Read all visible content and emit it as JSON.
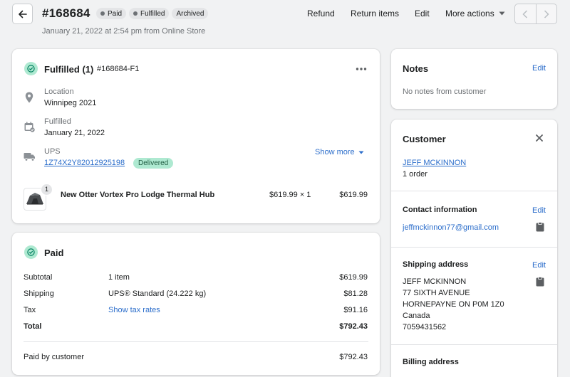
{
  "header": {
    "order_number": "#168684",
    "badges": [
      "Paid",
      "Fulfilled",
      "Archived"
    ],
    "subtitle": "January 21, 2022 at 2:54 pm from Online Store",
    "actions": {
      "refund": "Refund",
      "return_items": "Return items",
      "edit": "Edit",
      "more_actions": "More actions"
    }
  },
  "fulfilled": {
    "title": "Fulfilled (1)",
    "fulfillment_id": "#168684-F1",
    "location_label": "Location",
    "location_value": "Winnipeg 2021",
    "fulfilled_label": "Fulfilled",
    "fulfilled_value": "January 21, 2022",
    "carrier": "UPS",
    "tracking_number": "1Z74X2Y82012925198",
    "tracking_status": "Delivered",
    "show_more": "Show more",
    "item": {
      "quantity_badge": "1",
      "name": "New Otter Vortex Pro Lodge Thermal Hub",
      "unit_price": "$619.99 × 1",
      "total": "$619.99"
    }
  },
  "paid": {
    "title": "Paid",
    "rows": [
      {
        "label": "Subtotal",
        "detail": "1 item",
        "amount": "$619.99"
      },
      {
        "label": "Shipping",
        "detail": "UPS® Standard (24.222 kg)",
        "amount": "$81.28"
      },
      {
        "label": "Tax",
        "detail": "Show tax rates",
        "amount": "$91.16"
      },
      {
        "label": "Total",
        "detail": "",
        "amount": "$792.43"
      }
    ],
    "paid_by_label": "Paid by customer",
    "paid_by_amount": "$792.43"
  },
  "notes": {
    "title": "Notes",
    "edit": "Edit",
    "empty": "No notes from customer"
  },
  "customer": {
    "title": "Customer",
    "name": "JEFF MCKINNON",
    "orders": "1 order",
    "contact_title": "Contact information",
    "contact_edit": "Edit",
    "email": "jeffmckinnon77@gmail.com",
    "shipping_title": "Shipping address",
    "shipping_edit": "Edit",
    "address_lines": [
      "JEFF MCKINNON",
      "77 SIXTH AVENUE",
      "HORNEPAYNE ON P0M 1Z0",
      "Canada",
      "7059431562"
    ],
    "billing_title": "Billing address"
  }
}
